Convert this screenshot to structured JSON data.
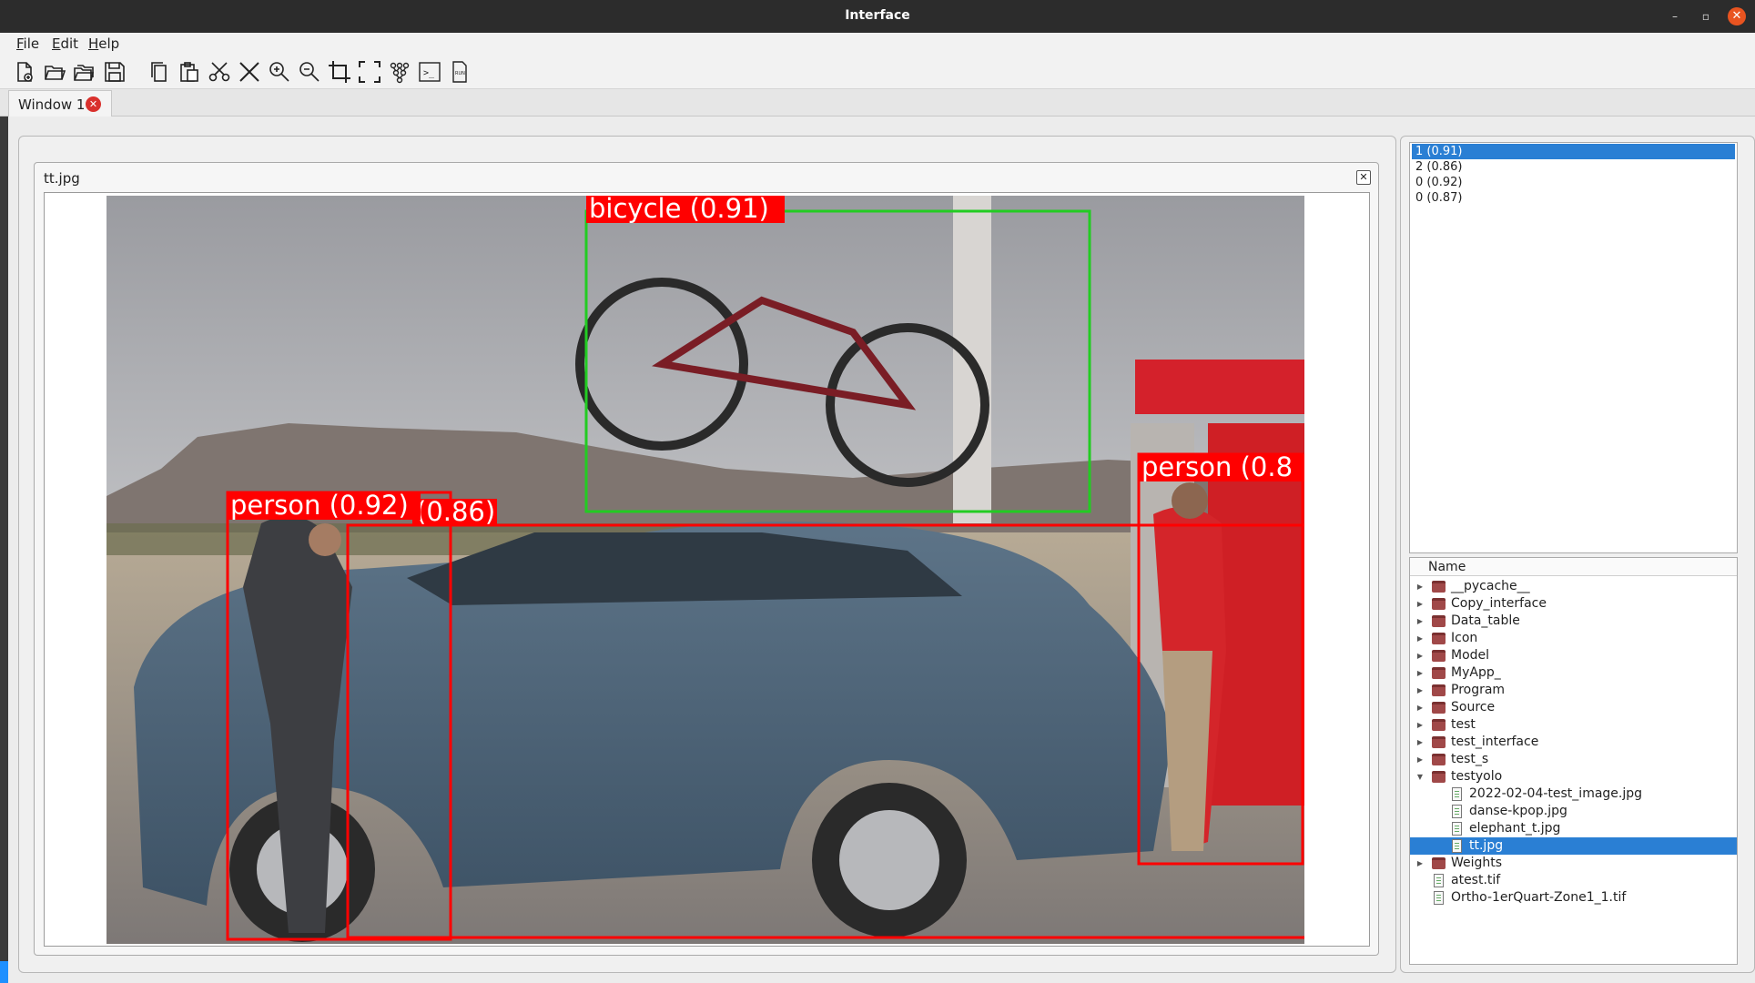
{
  "window": {
    "title": "Interface",
    "minimize": "–",
    "maximize": "▫",
    "close": "✕"
  },
  "menu": {
    "file": {
      "u": "F",
      "rest": "ile"
    },
    "edit": {
      "u": "E",
      "rest": "dit"
    },
    "help": {
      "u": "H",
      "rest": "elp"
    }
  },
  "toolbar": {
    "icons": [
      "new-file-icon",
      "open-folder-icon",
      "open-folders-icon",
      "save-icon",
      "copy-icon",
      "paste-icon",
      "cut-icon",
      "delete-icon",
      "zoom-in-icon",
      "zoom-out-icon",
      "crop-icon",
      "fullscreen-icon",
      "network-icon",
      "terminal-icon",
      "run-file-icon"
    ],
    "terminal_glyph": ">_",
    "run_label": "RUN"
  },
  "tabs": [
    {
      "label": "Window 1",
      "close": "✕"
    }
  ],
  "image_window": {
    "title": "tt.jpg",
    "close": "✕",
    "detections": [
      {
        "label": "bicycle (0.91)",
        "color": "#22cc22",
        "label_bg": "#ff0000"
      },
      {
        "label": "person (0.92)",
        "color": "#ff0000",
        "label_bg": "#ff0000"
      },
      {
        "label": "(0.86)",
        "color": "#ff0000",
        "label_bg": "#ff0000"
      },
      {
        "label": "person (0.8",
        "color": "#ff0000",
        "label_bg": "#ff0000"
      }
    ]
  },
  "detection_list": {
    "items": [
      {
        "text": "1 (0.91)",
        "selected": true
      },
      {
        "text": "2 (0.86)",
        "selected": false
      },
      {
        "text": "0 (0.92)",
        "selected": false
      },
      {
        "text": "0 (0.87)",
        "selected": false
      }
    ]
  },
  "file_tree": {
    "header": "Name",
    "nodes": [
      {
        "name": "__pycache__",
        "type": "folder",
        "expanded": false,
        "selected": false
      },
      {
        "name": "Copy_interface",
        "type": "folder",
        "expanded": false,
        "selected": false
      },
      {
        "name": "Data_table",
        "type": "folder",
        "expanded": false,
        "selected": false
      },
      {
        "name": "Icon",
        "type": "folder",
        "expanded": false,
        "selected": false
      },
      {
        "name": "Model",
        "type": "folder",
        "expanded": false,
        "selected": false
      },
      {
        "name": "MyApp_",
        "type": "folder",
        "expanded": false,
        "selected": false
      },
      {
        "name": "Program",
        "type": "folder",
        "expanded": false,
        "selected": false
      },
      {
        "name": "Source",
        "type": "folder",
        "expanded": false,
        "selected": false
      },
      {
        "name": "test",
        "type": "folder",
        "expanded": false,
        "selected": false
      },
      {
        "name": "test_interface",
        "type": "folder",
        "expanded": false,
        "selected": false
      },
      {
        "name": "test_s",
        "type": "folder",
        "expanded": false,
        "selected": false
      },
      {
        "name": "testyolo",
        "type": "folder",
        "expanded": true,
        "selected": false
      },
      {
        "name": "2022-02-04-test_image.jpg",
        "type": "file",
        "child": true,
        "selected": false
      },
      {
        "name": "danse-kpop.jpg",
        "type": "file",
        "child": true,
        "selected": false
      },
      {
        "name": "elephant_t.jpg",
        "type": "file",
        "child": true,
        "selected": false
      },
      {
        "name": "tt.jpg",
        "type": "file",
        "child": true,
        "selected": true
      },
      {
        "name": "Weights",
        "type": "folder",
        "expanded": false,
        "selected": false
      },
      {
        "name": "atest.tif",
        "type": "file",
        "selected": false
      },
      {
        "name": "Ortho-1erQuart-Zone1_1.tif",
        "type": "file",
        "selected": false
      }
    ]
  },
  "colors": {
    "accent": "#2a7fd4",
    "titlebar": "#2c2c2c",
    "close": "#e95420",
    "tab_close": "#d9302c",
    "folder": "#a04848"
  }
}
